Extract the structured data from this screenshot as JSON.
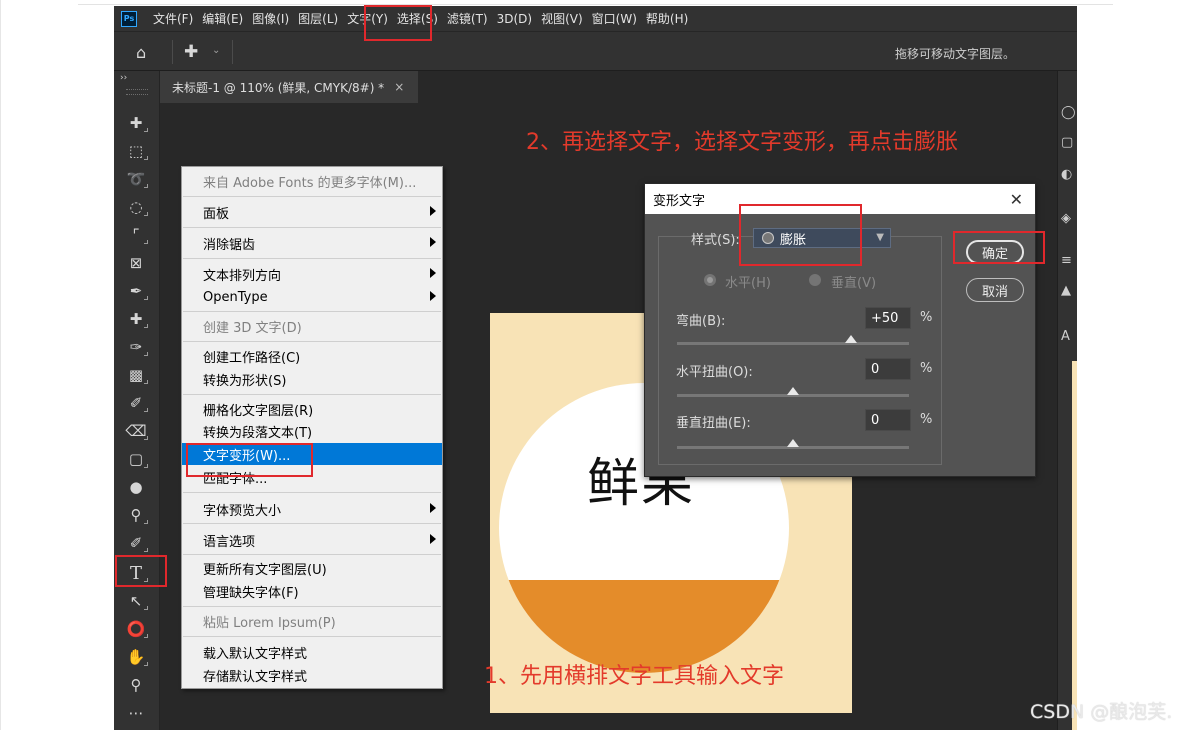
{
  "menubar": {
    "app_icon": "Ps",
    "items": [
      "文件(F)",
      "编辑(E)",
      "图像(I)",
      "图层(L)",
      "文字(Y)",
      "选择(S)",
      "滤镜(T)",
      "3D(D)",
      "视图(V)",
      "窗口(W)",
      "帮助(H)"
    ]
  },
  "options_bar": {
    "home_icon": "home-icon",
    "move_icon": "move-tool-icon",
    "hint": "拖移可移动文字图层。"
  },
  "tab": {
    "collapse_glyph": "››",
    "title": "未标题-1 @ 110% (鲜果, CMYK/8#) *",
    "close": "×"
  },
  "toolbar": {
    "tools": [
      "move",
      "marquee",
      "lasso",
      "quick-select",
      "crop",
      "frame",
      "eyedropper",
      "healing",
      "brush",
      "stamp",
      "history-brush",
      "eraser",
      "gradient",
      "blur",
      "dodge",
      "pen",
      "type",
      "path-select",
      "ellipse",
      "hand",
      "zoom",
      "more"
    ]
  },
  "canvas": {
    "document_text": "鲜果",
    "colors": {
      "background": "#f8e3b6",
      "circle_top": "#ffffff",
      "circle_bottom": "#e48c2a"
    }
  },
  "context_menu": {
    "items": [
      {
        "label": "来自 Adobe Fonts 的更多字体(M)...",
        "disabled": true
      },
      {
        "label": "面板",
        "submenu": true
      },
      {
        "label": "消除锯齿",
        "submenu": true
      },
      {
        "label": "文本排列方向",
        "submenu": true
      },
      {
        "label": "OpenType",
        "submenu": true
      },
      {
        "label": "创建 3D 文字(D)",
        "disabled": true
      },
      {
        "label": "创建工作路径(C)"
      },
      {
        "label": "转换为形状(S)"
      },
      {
        "label": "栅格化文字图层(R)"
      },
      {
        "label": "转换为段落文本(T)"
      },
      {
        "label": "文字变形(W)...",
        "selected": true
      },
      {
        "label": "匹配字体..."
      },
      {
        "label": "字体预览大小",
        "submenu": true
      },
      {
        "label": "语言选项",
        "submenu": true
      },
      {
        "label": "更新所有文字图层(U)"
      },
      {
        "label": "管理缺失字体(F)"
      },
      {
        "label": "粘贴 Lorem Ipsum(P)",
        "disabled": true
      },
      {
        "label": "载入默认文字样式"
      },
      {
        "label": "存储默认文字样式"
      }
    ]
  },
  "warp_dialog": {
    "title": "变形文字",
    "style_label": "样式(S):",
    "style_value": "膨胀",
    "horizontal": "水平(H)",
    "vertical": "垂直(V)",
    "bend_label": "弯曲(B):",
    "bend_value": "+50",
    "bend": 50,
    "hdist_label": "水平扭曲(O):",
    "hdist_value": "0",
    "hdist": 0,
    "vdist_label": "垂直扭曲(E):",
    "vdist_value": "0",
    "vdist": 0,
    "percent": "%",
    "ok": "确定",
    "cancel": "取消"
  },
  "annotations": {
    "step1": "1、先用横排文字工具输入文字",
    "step2": "2、再选择文字，选择文字变形，再点击膨胀",
    "color": "#e0282c"
  },
  "watermark": "CSDN @酿泡芙."
}
